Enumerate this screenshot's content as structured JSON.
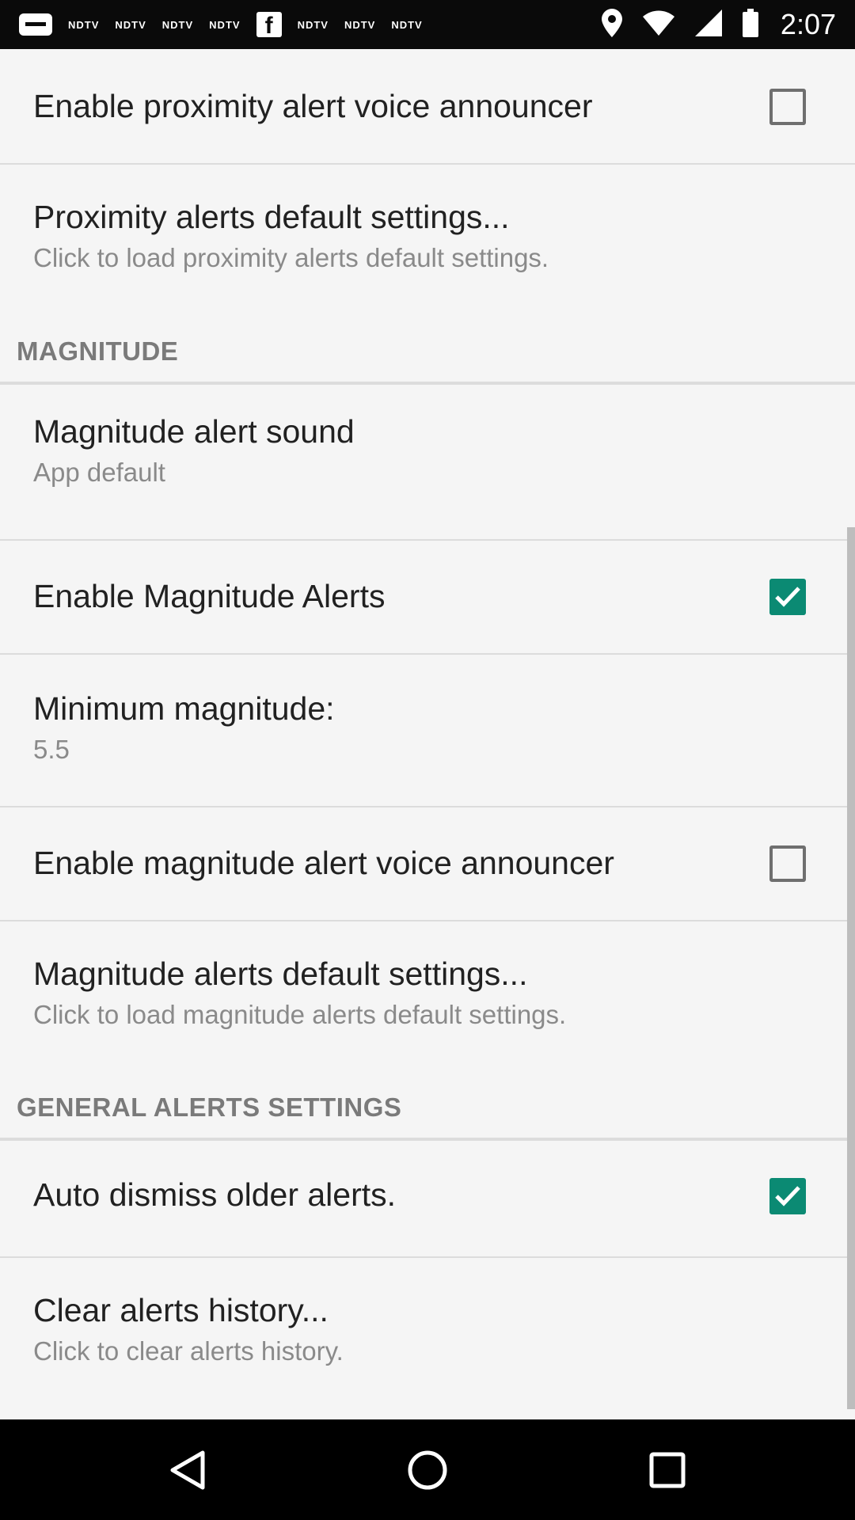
{
  "status_bar": {
    "time": "2:07",
    "notification_labels": [
      "NDTV",
      "NDTV",
      "NDTV",
      "NDTV",
      "NDTV",
      "NDTV",
      "NDTV"
    ],
    "facebook_glyph": "f"
  },
  "preferences": {
    "proximity_voice": {
      "title": "Enable proximity alert voice announcer",
      "checked": false
    },
    "proximity_defaults": {
      "title": "Proximity alerts default settings...",
      "summary": "Click to load proximity alerts default settings."
    },
    "magnitude_category": "MAGNITUDE",
    "magnitude_sound": {
      "title": "Magnitude alert sound",
      "summary": "App default"
    },
    "magnitude_enable": {
      "title": "Enable Magnitude Alerts",
      "checked": true
    },
    "min_magnitude": {
      "title": "Minimum magnitude:",
      "summary": "5.5"
    },
    "magnitude_voice": {
      "title": "Enable magnitude alert voice announcer",
      "checked": false
    },
    "magnitude_defaults": {
      "title": "Magnitude alerts default settings...",
      "summary": "Click to load magnitude alerts default settings."
    },
    "general_category": "GENERAL ALERTS SETTINGS",
    "auto_dismiss": {
      "title": "Auto dismiss older alerts.",
      "checked": true
    },
    "clear_history": {
      "title": "Clear alerts history...",
      "summary": "Click to clear alerts history."
    }
  },
  "colors": {
    "accent": "#0b8a73",
    "background": "#f5f5f5"
  },
  "icons": [
    "message-icon",
    "facebook-icon",
    "location-icon",
    "wifi-icon",
    "signal-icon",
    "battery-icon",
    "back-icon",
    "home-icon",
    "recents-icon"
  ]
}
